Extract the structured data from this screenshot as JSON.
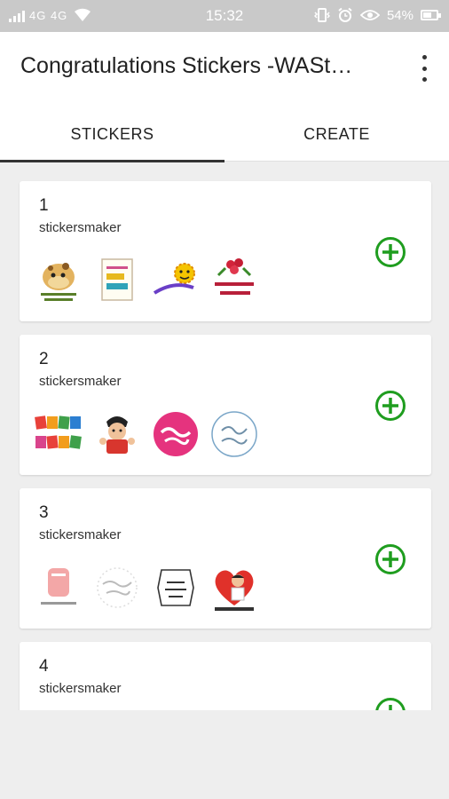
{
  "status_bar": {
    "network": "4G 4G",
    "time": "15:32",
    "battery": "54%",
    "battery_level": 0.54
  },
  "app_bar": {
    "title": "Congratulations Stickers -WASt…",
    "menu_icon": "more-vert-icon"
  },
  "tabs": [
    {
      "label": "STICKERS",
      "active": true
    },
    {
      "label": "CREATE",
      "active": false
    }
  ],
  "packs": [
    {
      "number": "1",
      "author": "stickersmaker",
      "stickers": [
        "giraffe-sticker",
        "have-a-nice-day-card-sticker",
        "sun-smiley-sticker",
        "roses-nice-day-sticker"
      ]
    },
    {
      "number": "2",
      "author": "stickersmaker",
      "stickers": [
        "good-luck-letters-sticker",
        "cartoon-boy-sticker",
        "pink-good-luck-sticker",
        "good-luck-circle-sticker"
      ]
    },
    {
      "number": "3",
      "author": "stickersmaker",
      "stickers": [
        "get-well-card-sticker",
        "get-well-soon-text-sticker",
        "frame-sticker",
        "doctor-heart-sticker"
      ]
    },
    {
      "number": "4",
      "author": "stickersmaker",
      "stickers": []
    }
  ],
  "colors": {
    "add_icon": "#1f9d1f",
    "status_bar": "#c9c9c9",
    "background": "#eeeeee"
  }
}
